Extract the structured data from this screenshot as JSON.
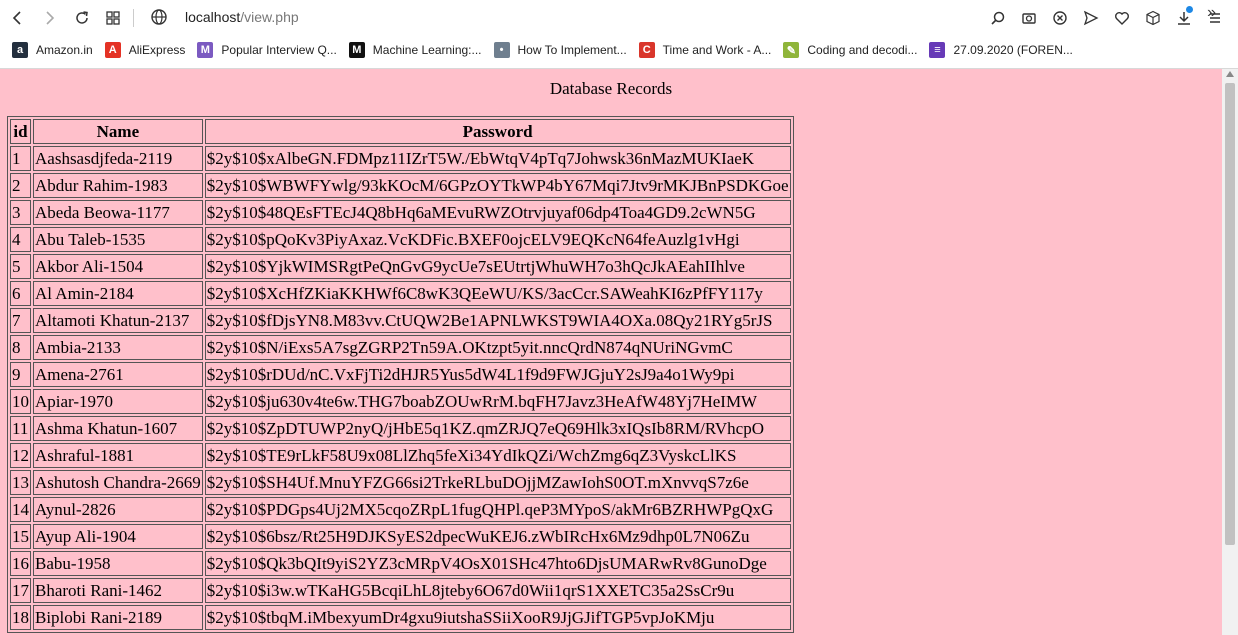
{
  "browser": {
    "url_host": "localhost",
    "url_path": "/view.php",
    "bookmarks": [
      {
        "label": "Amazon.in",
        "icon": "amazon-icon",
        "color": "#232f3e",
        "glyph": "a"
      },
      {
        "label": "AliExpress",
        "icon": "aliexpress-icon",
        "color": "#e43225",
        "glyph": "A"
      },
      {
        "label": "Popular Interview Q...",
        "icon": "gmail-icon",
        "color": "#7b5ac1",
        "glyph": "M"
      },
      {
        "label": "Machine Learning:...",
        "icon": "medium-icon",
        "color": "#111111",
        "glyph": "M"
      },
      {
        "label": "How To Implement...",
        "icon": "profile-icon",
        "color": "#6f7f8f",
        "glyph": "•"
      },
      {
        "label": "Time and Work - A...",
        "icon": "c-icon",
        "color": "#d9362b",
        "glyph": "C"
      },
      {
        "label": "Coding and decodi...",
        "icon": "pencil-icon",
        "color": "#8fb53a",
        "glyph": "✎"
      },
      {
        "label": "27.09.2020 (FOREN...",
        "icon": "forms-icon",
        "color": "#673ab7",
        "glyph": "≡"
      }
    ]
  },
  "page": {
    "heading": "Database Records",
    "columns": [
      "id",
      "Name",
      "Password"
    ],
    "rows": [
      [
        "1",
        "Aashsasdjfeda-2119",
        "$2y$10$xAlbeGN.FDMpz11IZrT5W./EbWtqV4pTq7Johwsk36nMazMUKIaeK"
      ],
      [
        "2",
        "Abdur Rahim-1983",
        "$2y$10$WBWFYwlg/93kKOcM/6GPzOYTkWP4bY67Mqi7Jtv9rMKJBnPSDKGoe"
      ],
      [
        "3",
        "Abeda Beowa-1177",
        "$2y$10$48QEsFTEcJ4Q8bHq6aMEvuRWZOtrvjuyaf06dp4Toa4GD9.2cWN5G"
      ],
      [
        "4",
        "Abu Taleb-1535",
        "$2y$10$pQoKv3PiyAxaz.VcKDFic.BXEF0ojcELV9EQKcN64feAuzlg1vHgi"
      ],
      [
        "5",
        "Akbor Ali-1504",
        "$2y$10$YjkWIMSRgtPeQnGvG9ycUe7sEUtrtjWhuWH7o3hQcJkAEahIIhlve"
      ],
      [
        "6",
        "Al Amin-2184",
        "$2y$10$XcHfZKiaKKHWf6C8wK3QEeWU/KS/3acCcr.SAWeahKI6zPfFY117y"
      ],
      [
        "7",
        "Altamoti Khatun-2137",
        "$2y$10$fDjsYN8.M83vv.CtUQW2Be1APNLWKST9WIA4OXa.08Qy21RYg5rJS"
      ],
      [
        "8",
        "Ambia-2133",
        "$2y$10$N/iExs5A7sgZGRP2Tn59A.OKtzpt5yit.nncQrdN874qNUriNGvmC"
      ],
      [
        "9",
        "Amena-2761",
        "$2y$10$rDUd/nC.VxFjTi2dHJR5Yus5dW4L1f9d9FWJGjuY2sJ9a4o1Wy9pi"
      ],
      [
        "10",
        "Apiar-1970",
        "$2y$10$ju630v4te6w.THG7boabZOUwRrM.bqFH7Javz3HeAfW48Yj7HeIMW"
      ],
      [
        "11",
        "Ashma Khatun-1607",
        "$2y$10$ZpDTUWP2nyQ/jHbE5q1KZ.qmZRJQ7eQ69Hlk3xIQsIb8RM/RVhcpO"
      ],
      [
        "12",
        "Ashraful-1881",
        "$2y$10$TE9rLkF58U9x08LlZhq5feXi34YdIkQZi/WchZmg6qZ3VyskcLlKS"
      ],
      [
        "13",
        "Ashutosh Chandra-2669",
        "$2y$10$SH4Uf.MnuYFZG66si2TrkeRLbuDOjjMZawIohS0OT.mXnvvqS7z6e"
      ],
      [
        "14",
        "Aynul-2826",
        "$2y$10$PDGps4Uj2MX5cqoZRpL1fugQHPl.qeP3MYpoS/akMr6BZRHWPgQxG"
      ],
      [
        "15",
        "Ayup Ali-1904",
        "$2y$10$6bsz/Rt25H9DJKSyES2dpecWuKEJ6.zWbIRcHx6Mz9dhp0L7N06Zu"
      ],
      [
        "16",
        "Babu-1958",
        "$2y$10$Qk3bQIt9yiS2YZ3cMRpV4OsX01SHc47hto6DjsUMARwRv8GunoDge"
      ],
      [
        "17",
        "Bharoti Rani-1462",
        "$2y$10$i3w.wTKaHG5BcqiLhL8jteby6O67d0Wii1qrS1XXETC35a2SsCr9u"
      ],
      [
        "18",
        "Biplobi Rani-2189",
        "$2y$10$tbqM.iMbexyumDr4gxu9iutshaSSiiXooR9JjGJifTGP5vpJoKMju"
      ]
    ]
  }
}
